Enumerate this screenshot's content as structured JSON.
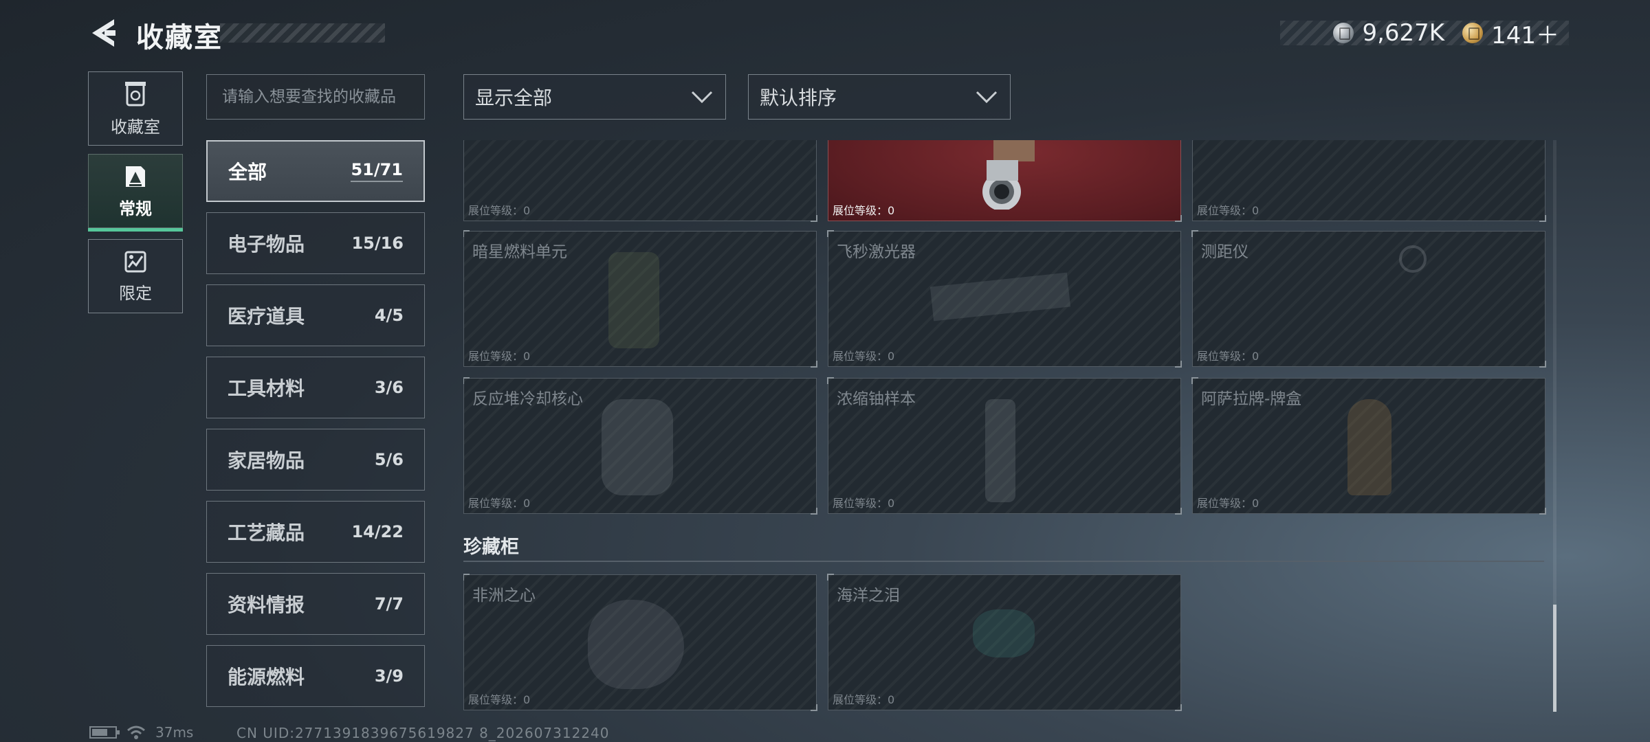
{
  "header": {
    "title": "收藏室",
    "currency": [
      {
        "icon": "silver-coin-icon",
        "value": "9,627K"
      },
      {
        "icon": "gold-coin-icon",
        "value": "141＋"
      }
    ]
  },
  "side_tabs": [
    {
      "label": "收藏室",
      "icon": "collection-room-icon",
      "active": false
    },
    {
      "label": "常规",
      "icon": "regular-icon",
      "active": true
    },
    {
      "label": "限定",
      "icon": "limited-icon",
      "active": false
    }
  ],
  "search": {
    "placeholder": "请输入想要查找的收藏品",
    "value": ""
  },
  "categories": [
    {
      "name": "全部",
      "count": "51/71",
      "active": true
    },
    {
      "name": "电子物品",
      "count": "15/16"
    },
    {
      "name": "医疗道具",
      "count": "4/5"
    },
    {
      "name": "工具材料",
      "count": "3/6"
    },
    {
      "name": "家居物品",
      "count": "5/6"
    },
    {
      "name": "工艺藏品",
      "count": "14/22"
    },
    {
      "name": "资料情报",
      "count": "7/7"
    },
    {
      "name": "能源燃料",
      "count": "3/9"
    }
  ],
  "filters": {
    "display": "显示全部",
    "sort": "默认排序"
  },
  "grid": {
    "row0": [
      {
        "name": "",
        "level": "展位等级：0"
      },
      {
        "name": "",
        "level": "展位等级：0",
        "highlight": "#5a1d22"
      },
      {
        "name": "",
        "level": "展位等级：0"
      }
    ],
    "row1": [
      {
        "name": "暗星燃料单元",
        "level": "展位等级：0"
      },
      {
        "name": "飞秒激光器",
        "level": "展位等级：0"
      },
      {
        "name": "测距仪",
        "level": "展位等级：0"
      }
    ],
    "row2": [
      {
        "name": "反应堆冷却核心",
        "level": "展位等级：0"
      },
      {
        "name": "浓缩铀样本",
        "level": "展位等级：0"
      },
      {
        "name": "阿萨拉牌-牌盒",
        "level": "展位等级：0"
      }
    ]
  },
  "treasure_section": {
    "title": "珍藏柜",
    "items": [
      {
        "name": "非洲之心",
        "level": "展位等级：0"
      },
      {
        "name": "海洋之泪",
        "level": "展位等级：0"
      }
    ]
  },
  "status_bar": {
    "ping": "37ms",
    "uid": "CN UID:2771391839675619827 8_202607312240"
  },
  "colors": {
    "accent": "#56c79a",
    "highlight_card": "#5a1d22"
  }
}
